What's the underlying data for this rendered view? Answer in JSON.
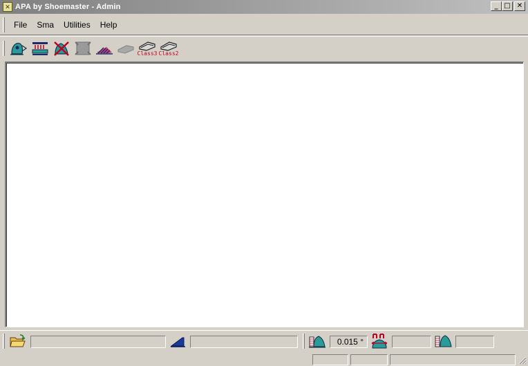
{
  "window": {
    "title": "APA by Shoemaster - Admin",
    "controls": {
      "minimize": "_",
      "maximize": "□",
      "close": "✕"
    }
  },
  "menu": {
    "items": [
      {
        "label": "File"
      },
      {
        "label": "Sma"
      },
      {
        "label": "Utilities"
      },
      {
        "label": "Help"
      }
    ]
  },
  "toolbar": {
    "buttons": [
      {
        "icon": "shoe-last-arrow-icon"
      },
      {
        "icon": "sole-press-icon"
      },
      {
        "icon": "last-cross-icon"
      },
      {
        "icon": "gray-pattern-icon"
      },
      {
        "icon": "striped-heel-icon"
      },
      {
        "icon": "gray-sole-icon"
      },
      {
        "icon": "class3-sole-icon",
        "label": "Class3"
      },
      {
        "icon": "class2-sole-icon",
        "label": "Class2"
      }
    ]
  },
  "bottom_bar": {
    "angle_value": "0.015 °",
    "field1_value": "",
    "field2_value": "",
    "field3_value": "",
    "field4_value": ""
  },
  "colors": {
    "face": "#d4d0c8",
    "teal": "#1a8a8a",
    "red": "#c00020",
    "navy": "#1a2a6a"
  }
}
